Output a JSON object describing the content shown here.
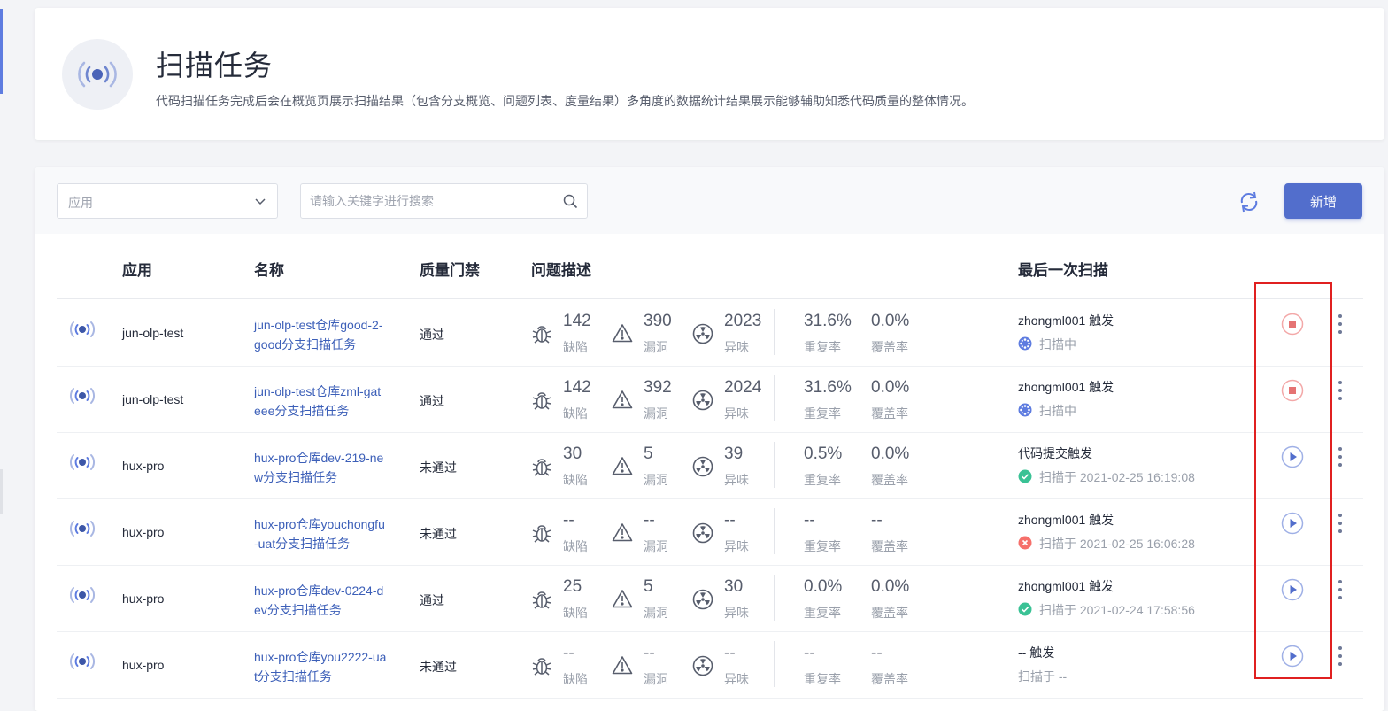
{
  "header": {
    "title": "扫描任务",
    "description": "代码扫描任务完成后会在概览页展示扫描结果（包含分支概览、问题列表、度量结果）多角度的数据统计结果展示能够辅助知悉代码质量的整体情况。",
    "icon": "radio-signal-icon"
  },
  "toolbar": {
    "app_select_placeholder": "应用",
    "search_placeholder": "请输入关键字进行搜索",
    "add_label": "新增"
  },
  "table": {
    "headers": {
      "app": "应用",
      "name": "名称",
      "gate": "质量门禁",
      "issues": "问题描述",
      "last_scan": "最后一次扫描"
    },
    "labels": {
      "bugs": "缺陷",
      "vulns": "漏洞",
      "smells": "异味",
      "dup": "重复率",
      "cov": "覆盖率"
    },
    "rows": [
      {
        "app": "jun-olp-test",
        "name": "jun-olp-test仓库good-2-good分支扫描任务",
        "gate": "通过",
        "bugs": "142",
        "vulns": "390",
        "smells": "2023",
        "dup": "31.6%",
        "cov": "0.0%",
        "trigger": "zhongml001 触发",
        "status": "扫描中",
        "status_type": "scanning",
        "action": "stop"
      },
      {
        "app": "jun-olp-test",
        "name": "jun-olp-test仓库zml-gateee分支扫描任务",
        "gate": "通过",
        "bugs": "142",
        "vulns": "392",
        "smells": "2024",
        "dup": "31.6%",
        "cov": "0.0%",
        "trigger": "zhongml001 触发",
        "status": "扫描中",
        "status_type": "scanning",
        "action": "stop"
      },
      {
        "app": "hux-pro",
        "name": "hux-pro仓库dev-219-new分支扫描任务",
        "gate": "未通过",
        "bugs": "30",
        "vulns": "5",
        "smells": "39",
        "dup": "0.5%",
        "cov": "0.0%",
        "trigger": "代码提交触发",
        "status": "扫描于 2021-02-25 16:19:08",
        "status_type": "success",
        "action": "play"
      },
      {
        "app": "hux-pro",
        "name": "hux-pro仓库youchongfu-uat分支扫描任务",
        "gate": "未通过",
        "bugs": "--",
        "vulns": "--",
        "smells": "--",
        "dup": "--",
        "cov": "--",
        "trigger": "zhongml001 触发",
        "status": "扫描于 2021-02-25 16:06:28",
        "status_type": "failed",
        "action": "play"
      },
      {
        "app": "hux-pro",
        "name": "hux-pro仓库dev-0224-dev分支扫描任务",
        "gate": "通过",
        "bugs": "25",
        "vulns": "5",
        "smells": "30",
        "dup": "0.0%",
        "cov": "0.0%",
        "trigger": "zhongml001 触发",
        "status": "扫描于 2021-02-24 17:58:56",
        "status_type": "success",
        "action": "play"
      },
      {
        "app": "hux-pro",
        "name": "hux-pro仓库you2222-uat分支扫描任务",
        "gate": "未通过",
        "bugs": "--",
        "vulns": "--",
        "smells": "--",
        "dup": "--",
        "cov": "--",
        "trigger": "-- 触发",
        "status": "扫描于 --",
        "status_type": "none",
        "action": "play"
      }
    ]
  },
  "colors": {
    "accent": "#526ecc",
    "link": "#3c5fb8",
    "success": "#3ac295",
    "danger": "#f66f6a",
    "highlight": "#e02020"
  }
}
